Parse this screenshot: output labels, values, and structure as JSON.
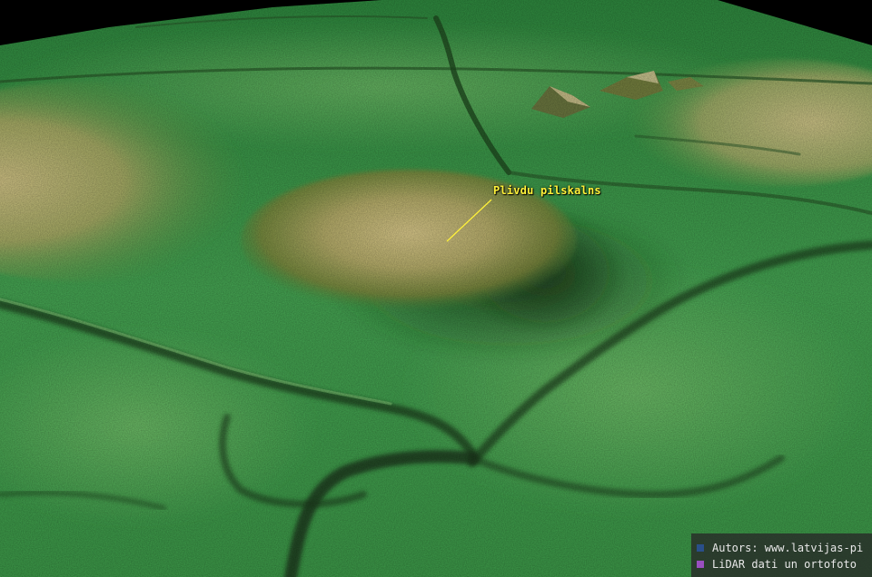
{
  "map": {
    "type": "lidar-relief-3d",
    "site_label": "Plivdu pilskalns"
  },
  "legend": {
    "items": [
      {
        "text": "Autors: www.latvijas-pi",
        "color": "#2a4f8a"
      },
      {
        "text": "LiDAR dati un ortofoto",
        "color": "#9a4fbf"
      }
    ]
  },
  "colors": {
    "label": "#fff23a",
    "terrain_low": "#3f9f4a",
    "terrain_high": "#d6c98a",
    "sky": "#000000"
  }
}
